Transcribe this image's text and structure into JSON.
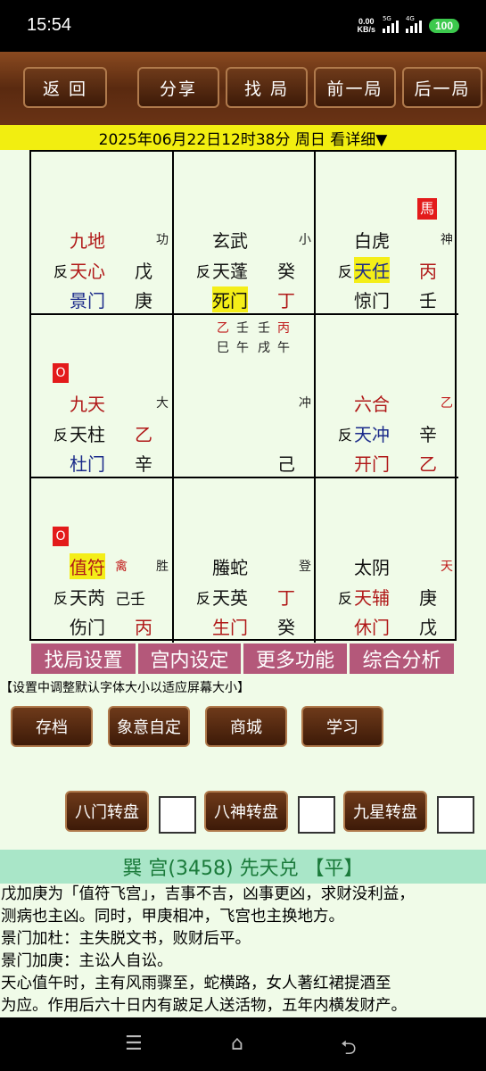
{
  "status": {
    "time": "15:54",
    "speed_value": "0.00",
    "speed_unit": "KB/s",
    "sig1": "5G",
    "sig2": "4G",
    "battery": "100"
  },
  "toolbar": {
    "back": "返 回",
    "share": "分享",
    "find": "找 局",
    "prev": "前一局",
    "next": "后一局"
  },
  "date_line": "2025年06月22日12时38分 周日 看详细▼",
  "cells": {
    "c1": {
      "god": "九地",
      "tag": "功",
      "fan": "反",
      "star": "天心",
      "stem1": "戊",
      "door": "景门",
      "stem2": "庚"
    },
    "c2": {
      "god": "玄武",
      "tag": "小",
      "fan": "反",
      "star": "天蓬",
      "stem1": "癸",
      "door": "死门",
      "stem2": "丁"
    },
    "c3": {
      "mark": "馬",
      "god": "白虎",
      "tag": "神",
      "fan": "反",
      "star": "天任",
      "stem1": "丙",
      "door": "惊门",
      "stem2": "壬"
    },
    "c4": {
      "mark": "O",
      "god": "九天",
      "tag": "大",
      "fan": "反",
      "star": "天柱",
      "stem1": "乙",
      "door": "杜门",
      "stem2": "辛"
    },
    "c5": {
      "p1": "乙",
      "p2": "壬",
      "p3": "壬",
      "p4": "丙",
      "q1": "巳",
      "q2": "午",
      "q3": "戌",
      "q4": "午",
      "tag": "冲",
      "stem": "己"
    },
    "c6": {
      "god": "六合",
      "tag": "乙",
      "fan": "反",
      "star": "天冲",
      "stem1": "辛",
      "door": "开门",
      "stem2": "乙"
    },
    "c7": {
      "mark": "O",
      "god": "值符",
      "qin": "禽",
      "tag": "胜",
      "fan": "反",
      "star": "天芮",
      "stem1": "己壬",
      "door": "伤门",
      "stem2": "丙"
    },
    "c8": {
      "god": "螣蛇",
      "tag": "登",
      "fan": "反",
      "star": "天英",
      "stem1": "丁",
      "door": "生门",
      "stem2": "癸"
    },
    "c9": {
      "god": "太阴",
      "tag": "天",
      "fan": "反",
      "star": "天辅",
      "stem1": "庚",
      "door": "休门",
      "stem2": "戊"
    }
  },
  "menu": [
    "找局设置",
    "宫内设定",
    "更多功能",
    "综合分析"
  ],
  "hint": "【设置中调整默认字体大小以适应屏幕大小】",
  "buttons": {
    "save": "存档",
    "yiyi": "象意自定",
    "shop": "商城",
    "learn": "学习",
    "bamen": "八门转盘",
    "bashen": "八神转盘",
    "jiuxing": "九星转盘"
  },
  "section_title": "巽 宫(3458) 先天兑 【平】",
  "description": [
    "戊加庚为「值符飞宫」，吉事不吉，凶事更凶，求财没利益，",
    "测病也主凶。同时，甲庚相冲，飞宫也主换地方。",
    "景门加杜：主失脱文书，败财后平。",
    "景门加庚：主讼人自讼。",
    "天心值午时，主有风雨骤至，蛇横路，女人著红裙提酒至",
    "为应。作用后六十日内有跛足人送活物，五年内横发财产。"
  ]
}
